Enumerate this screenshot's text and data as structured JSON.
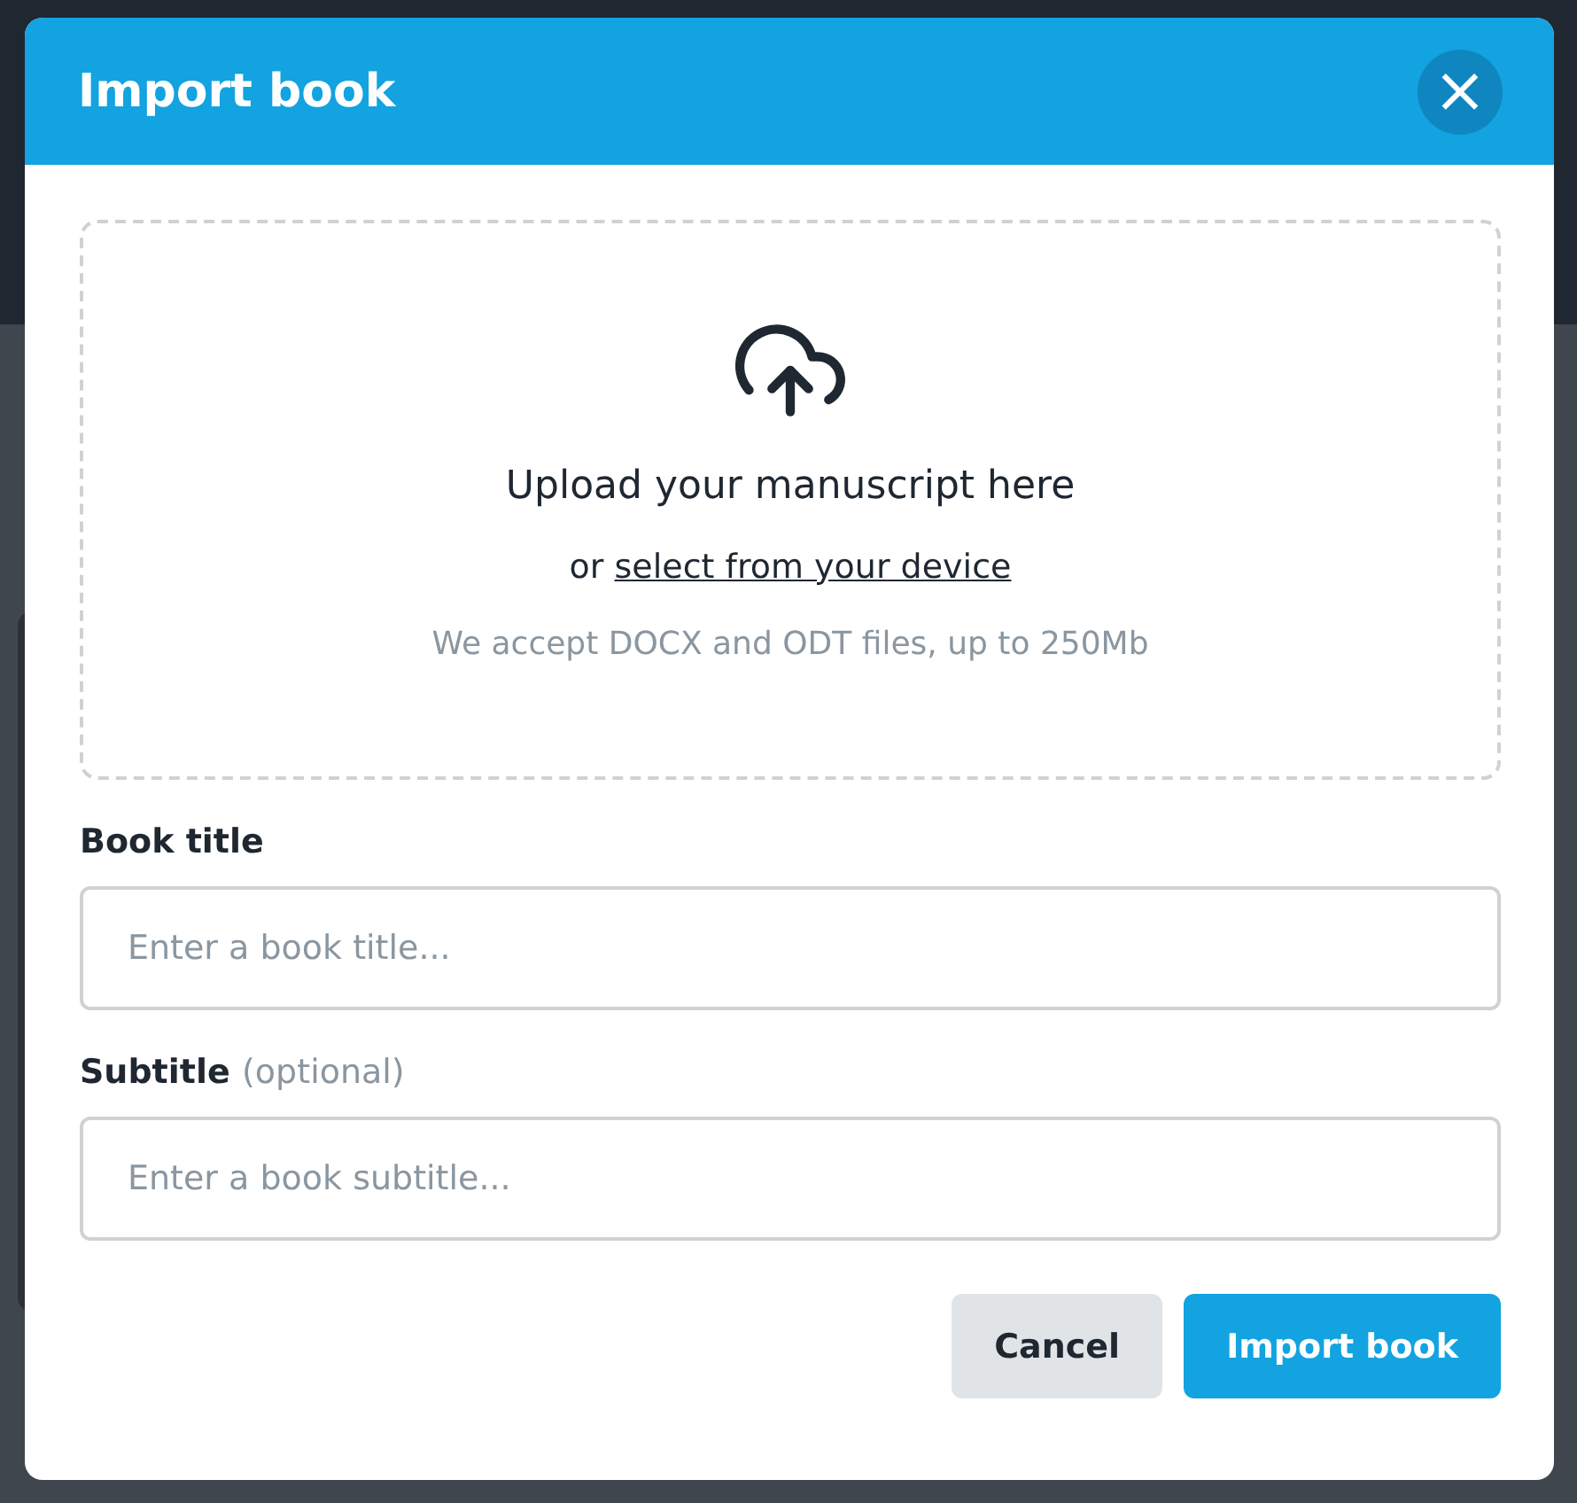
{
  "dialog": {
    "title": "Import book",
    "close_label": "×"
  },
  "upload": {
    "heading": "Upload your manuscript here",
    "prompt": "or",
    "link": "select from your device",
    "note": "We accept DOCX and ODT files, up to 250Mb"
  },
  "fields": [
    {
      "label": "Book title",
      "placeholder": "Enter a book title..."
    },
    {
      "label": "Subtitle",
      "hint": "(optional)",
      "placeholder": "Enter a book subtitle..."
    }
  ],
  "buttons": [
    {
      "label": "Cancel",
      "kind": "secondary"
    },
    {
      "label": "Import book",
      "kind": "primary"
    }
  ]
}
